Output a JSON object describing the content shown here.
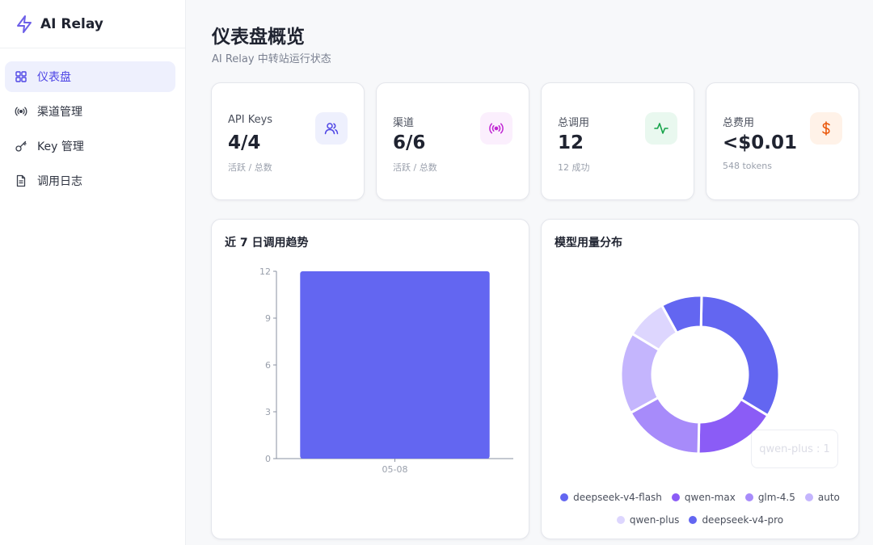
{
  "app": {
    "name": "AI Relay"
  },
  "sidebar": {
    "items": [
      {
        "label": "仪表盘",
        "icon": "dashboard-icon",
        "active": true
      },
      {
        "label": "渠道管理",
        "icon": "broadcast-icon",
        "active": false
      },
      {
        "label": "Key 管理",
        "icon": "key-icon",
        "active": false
      },
      {
        "label": "调用日志",
        "icon": "document-icon",
        "active": false
      }
    ]
  },
  "header": {
    "title": "仪表盘概览",
    "subtitle": "AI Relay 中转站运行状态"
  },
  "stats": [
    {
      "label": "API Keys",
      "value": "4/4",
      "sub": "活跃 / 总数",
      "icon": "users-icon",
      "icon_color": "#4f46e5",
      "icon_bg": "#eef0fd"
    },
    {
      "label": "渠道",
      "value": "6/6",
      "sub": "活跃 / 总数",
      "icon": "broadcast-icon",
      "icon_color": "#c026d3",
      "icon_bg": "#fbeffd"
    },
    {
      "label": "总调用",
      "value": "12",
      "sub": "12 成功",
      "icon": "activity-icon",
      "icon_color": "#16a34a",
      "icon_bg": "#e9f8ef"
    },
    {
      "label": "总费用",
      "value": "<$0.01",
      "sub": "548 tokens",
      "icon": "dollar-icon",
      "icon_color": "#ea580c",
      "icon_bg": "#fff2e8"
    }
  ],
  "trend_panel": {
    "title": "近 7 日调用趋势"
  },
  "model_panel": {
    "title": "模型用量分布"
  },
  "tooltip": {
    "text": "qwen-plus : 1"
  },
  "chart_data": [
    {
      "type": "bar",
      "categories": [
        "05-08"
      ],
      "values": [
        12
      ],
      "ylim": [
        0,
        12
      ],
      "yticks": [
        0,
        3,
        6,
        9,
        12
      ],
      "color": "#6366f1",
      "grid": false
    },
    {
      "type": "pie",
      "donut": true,
      "slices": [
        {
          "label": "deepseek-v4-flash",
          "value": 4,
          "color": "#6366f1"
        },
        {
          "label": "qwen-max",
          "value": 2,
          "color": "#8b5cf6"
        },
        {
          "label": "glm-4.5",
          "value": 2,
          "color": "#a78bfa"
        },
        {
          "label": "auto",
          "value": 2,
          "color": "#c4b5fd"
        },
        {
          "label": "qwen-plus",
          "value": 1,
          "color": "#ddd6fe"
        },
        {
          "label": "deepseek-v4-pro",
          "value": 1,
          "color": "#6366f1"
        }
      ],
      "legend_position": "bottom"
    }
  ]
}
